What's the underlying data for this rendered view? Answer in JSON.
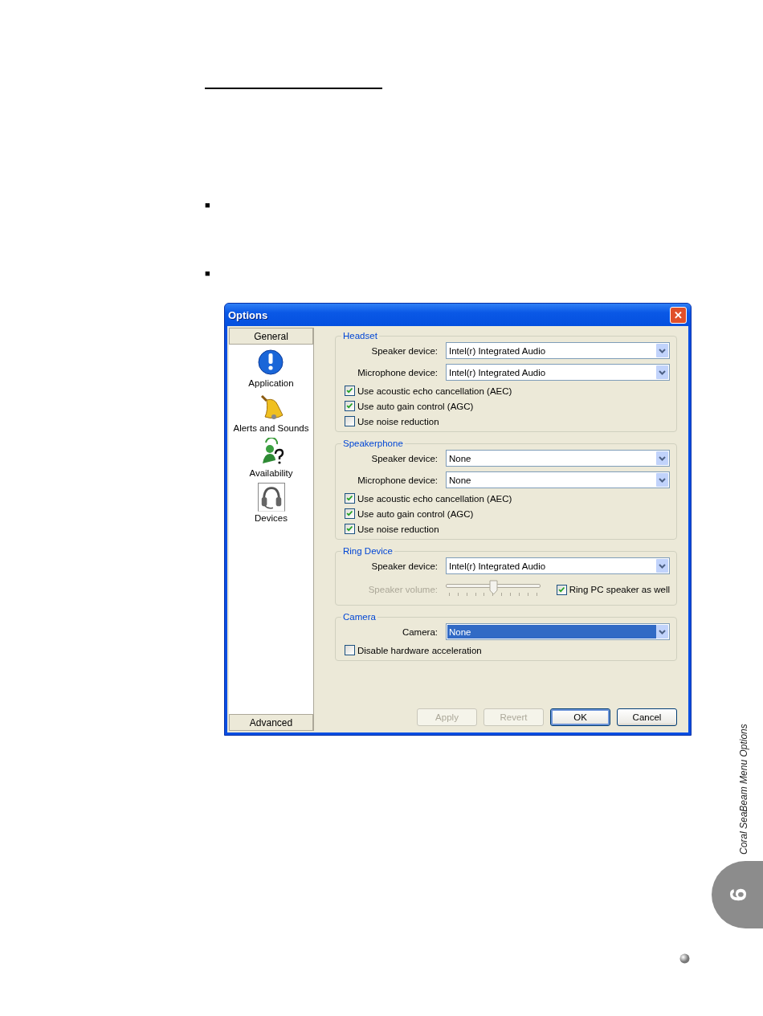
{
  "page": {
    "bullets": [
      "■",
      "■"
    ],
    "side_tab": {
      "title": "Coral SeaBeam Menu Options",
      "chapter": "6"
    }
  },
  "window": {
    "title": "Options",
    "close": "✕"
  },
  "sidebar": {
    "header": "General",
    "items": [
      {
        "label": "Application",
        "kind": "info",
        "selected": false
      },
      {
        "label": "Alerts and Sounds",
        "kind": "bell",
        "selected": false
      },
      {
        "label": "Availability",
        "kind": "presence",
        "selected": false
      },
      {
        "label": "Devices",
        "kind": "headset",
        "selected": true
      }
    ],
    "footer": "Advanced"
  },
  "groups": [
    {
      "title": "Headset",
      "fields": [
        {
          "label": "Speaker device:",
          "value": "Intel(r) Integrated Audio",
          "focused": false
        },
        {
          "label": "Microphone device:",
          "value": "Intel(r) Integrated Audio",
          "focused": false
        }
      ],
      "checks": [
        {
          "label": "Use acoustic echo cancellation (AEC)",
          "checked": true
        },
        {
          "label": "Use auto gain control (AGC)",
          "checked": true
        },
        {
          "label": "Use noise reduction",
          "checked": false
        }
      ]
    },
    {
      "title": "Speakerphone",
      "fields": [
        {
          "label": "Speaker device:",
          "value": "None",
          "focused": false
        },
        {
          "label": "Microphone device:",
          "value": "None",
          "focused": false
        }
      ],
      "checks": [
        {
          "label": "Use acoustic echo cancellation (AEC)",
          "checked": true
        },
        {
          "label": "Use auto gain control (AGC)",
          "checked": true
        },
        {
          "label": "Use noise reduction",
          "checked": true
        }
      ]
    },
    {
      "title": "Ring Device",
      "fields": [
        {
          "label": "Speaker device:",
          "value": "Intel(r) Integrated Audio",
          "focused": false
        }
      ],
      "slider": {
        "label": "Speaker volume:",
        "level": 0.5,
        "disabled": true,
        "check": {
          "label": "Ring PC speaker as well",
          "checked": true
        }
      }
    },
    {
      "title": "Camera",
      "fields": [
        {
          "label": "Camera:",
          "value": "None",
          "focused": true
        }
      ],
      "checks": [
        {
          "label": "Disable hardware acceleration",
          "checked": false
        }
      ]
    }
  ],
  "buttons": [
    {
      "label": "Apply",
      "disabled": true,
      "default": false
    },
    {
      "label": "Revert",
      "disabled": true,
      "default": false
    },
    {
      "label": "OK",
      "disabled": false,
      "default": true
    },
    {
      "label": "Cancel",
      "disabled": false,
      "default": false
    }
  ]
}
